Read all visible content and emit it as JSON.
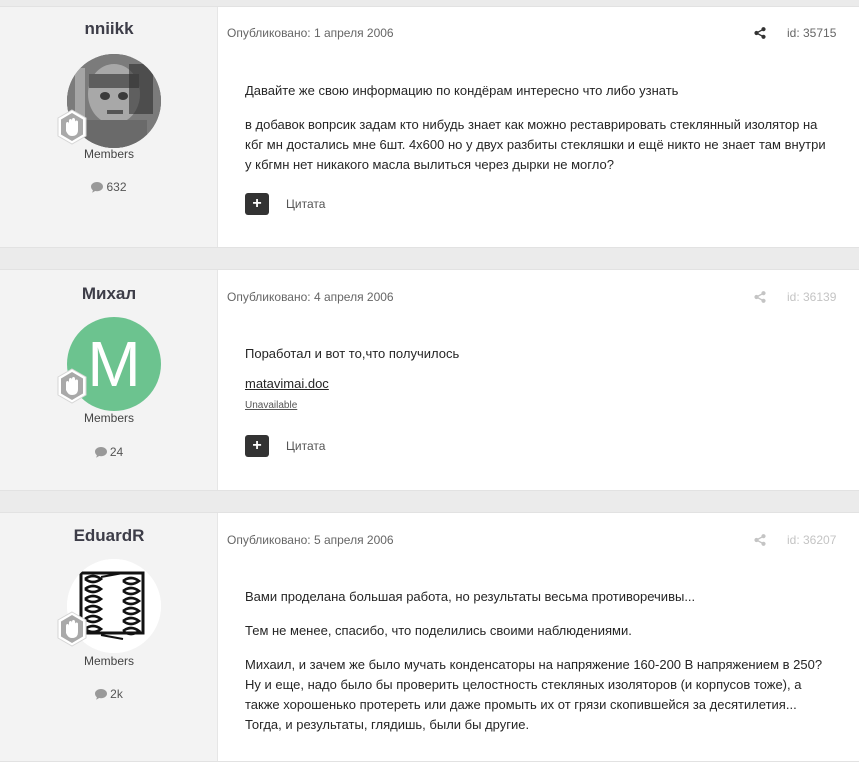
{
  "posts": [
    {
      "author": "nniikk",
      "avatar_type": "photo",
      "group": "Members",
      "post_count": "632",
      "date": "Опубликовано: 1 апреля 2006",
      "post_id": "id: 35715",
      "paragraphs": [
        "Давайте же свою информацию по кондёрам интересно что либо узнать",
        "в добавок вопрсик задам кто нибудь знает как можно реставрировать стеклянный изолятор на кбг мн достались мне 6шт. 4х600 но у двух разбиты стекляшки и ещё никто не знает там внутри у кбгмн нет никакого масла вылиться через дырки не могло?"
      ],
      "quote_label": "Цитата"
    },
    {
      "author": "Михал",
      "avatar_type": "letter",
      "avatar_letter": "M",
      "avatar_color": "#6cc38f",
      "group": "Members",
      "post_count": "24",
      "date": "Опубликовано: 4 апреля 2006",
      "post_id": "id: 36139",
      "paragraphs": [
        "Поработал и вот то,что получилось"
      ],
      "attachment": {
        "name": "matavimai.doc",
        "status": "Unavailable"
      },
      "quote_label": "Цитата"
    },
    {
      "author": "EduardR",
      "avatar_type": "coil-drawing",
      "group": "Members",
      "post_count": "2k",
      "date": "Опубликовано: 5 апреля 2006",
      "post_id": "id: 36207",
      "paragraphs": [
        "Вами проделана большая работа, но результаты весьма противоречивы...",
        "Тем не менее, спасибо, что поделились своими наблюдениями.",
        "Михаил, и зачем же было мучать конденсаторы на напряжение 160-200 В напряжением в 250? Ну и еще, надо было бы проверить целостность стекляных изоляторов (и корпусов тоже), а также хорошенько протереть или даже промыть их от грязи скопившейся за десятилетия... Тогда, и результаты, глядишь, были бы другие."
      ]
    }
  ],
  "icons": {
    "share": "share-icon",
    "comments": "comment-bubble-icon",
    "rank": "waving-hand-badge-icon",
    "multiquote": "plus-icon"
  },
  "colors": {
    "page_bg": "#ebebeb",
    "author_bg": "#f3f3f3",
    "button_dark": "#333333"
  }
}
